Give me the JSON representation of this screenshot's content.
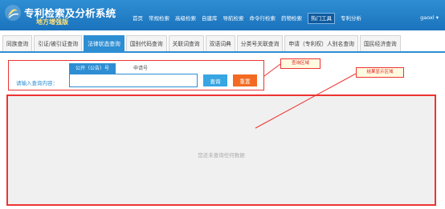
{
  "app": {
    "title": "专利检索及分析系统",
    "subtitle": "地方增强版",
    "user": "gaoxl"
  },
  "nav": {
    "items": [
      {
        "label": "首页",
        "active": false
      },
      {
        "label": "常规检索",
        "active": false
      },
      {
        "label": "高级检索",
        "active": false
      },
      {
        "label": "自建库",
        "active": false
      },
      {
        "label": "导航检索",
        "active": false
      },
      {
        "label": "命令行检索",
        "active": false
      },
      {
        "label": "药物检索",
        "active": false
      },
      {
        "label": "热门工具",
        "active": true
      },
      {
        "label": "专利分析",
        "active": false
      }
    ]
  },
  "tabs": {
    "items": [
      {
        "label": "同族查询",
        "active": false
      },
      {
        "label": "引证/被引证查询",
        "active": false
      },
      {
        "label": "法律状态查询",
        "active": true
      },
      {
        "label": "国别代码查询",
        "active": false
      },
      {
        "label": "关联词查询",
        "active": false
      },
      {
        "label": "双语词典",
        "active": false
      },
      {
        "label": "分类号关联查询",
        "active": false
      },
      {
        "label": "申请（专利权）人别名查询",
        "active": false
      },
      {
        "label": "国民经济查询",
        "active": false
      }
    ]
  },
  "query": {
    "sub_tab_active": "公开（公告）号",
    "sub_tab_inactive": "申请号",
    "label": "请输入查询内容：",
    "input_value": "",
    "query_button": "查询",
    "reset_button": "重置"
  },
  "annotations": {
    "query_area": "查询区域",
    "result_area": "结果显示区域"
  },
  "result": {
    "empty_text": "您还未查询任何数据"
  },
  "colors": {
    "header": "#1b73bd",
    "accent": "#2e8ed3",
    "query_button": "#37a6e3",
    "reset_button": "#f36b22",
    "annotation": "#e33333"
  }
}
